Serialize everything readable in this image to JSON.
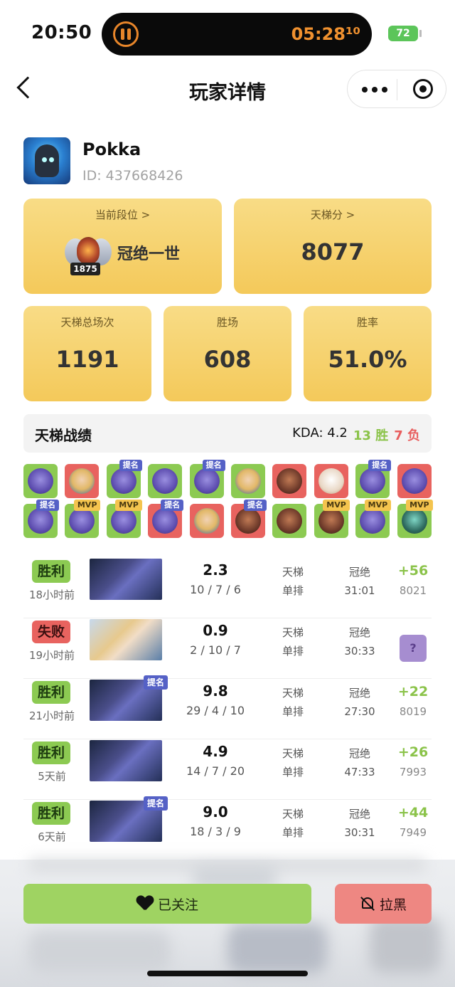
{
  "status_bar": {
    "time": "20:50",
    "timer": "05:28¹⁰",
    "battery": "72"
  },
  "nav": {
    "title": "玩家详情"
  },
  "profile": {
    "username": "Pokka",
    "id_text": "ID: 437668426"
  },
  "rank_card": {
    "label": "当前段位 >",
    "rank_name": "冠绝一世",
    "rank_number": "1875"
  },
  "ladder_card": {
    "label": "天梯分 >",
    "value": "8077"
  },
  "stats": [
    {
      "label": "天梯总场次",
      "value": "1191"
    },
    {
      "label": "胜场",
      "value": "608"
    },
    {
      "label": "胜率",
      "value": "51.0%"
    }
  ],
  "ladder_record": {
    "title": "天梯战绩",
    "kda_text": "KDA: 4.2",
    "wins_text": "13 胜",
    "losses_text": "7 负"
  },
  "hero_grid": {
    "tiles": [
      {
        "result": "win",
        "hero": "purple",
        "tag": ""
      },
      {
        "result": "loss",
        "hero": "blonde",
        "tag": ""
      },
      {
        "result": "win",
        "hero": "purple",
        "tag": "提名"
      },
      {
        "result": "win",
        "hero": "purple",
        "tag": ""
      },
      {
        "result": "win",
        "hero": "purple",
        "tag": "提名"
      },
      {
        "result": "win",
        "hero": "blonde",
        "tag": ""
      },
      {
        "result": "loss",
        "hero": "brown",
        "tag": ""
      },
      {
        "result": "loss",
        "hero": "white",
        "tag": ""
      },
      {
        "result": "win",
        "hero": "purple",
        "tag": "提名"
      },
      {
        "result": "loss",
        "hero": "purple",
        "tag": ""
      },
      {
        "result": "win",
        "hero": "purple",
        "tag": "提名"
      },
      {
        "result": "win",
        "hero": "purple",
        "tag": "MVP"
      },
      {
        "result": "win",
        "hero": "purple",
        "tag": "MVP"
      },
      {
        "result": "loss",
        "hero": "purple",
        "tag": "提名"
      },
      {
        "result": "loss",
        "hero": "blonde",
        "tag": ""
      },
      {
        "result": "loss",
        "hero": "brown",
        "tag": "提名"
      },
      {
        "result": "win",
        "hero": "brown",
        "tag": ""
      },
      {
        "result": "win",
        "hero": "brown",
        "tag": "MVP"
      },
      {
        "result": "win",
        "hero": "purple",
        "tag": "MVP"
      },
      {
        "result": "win",
        "hero": "teal",
        "tag": "MVP"
      }
    ]
  },
  "matches": [
    {
      "result": "胜利",
      "outcome": "win",
      "time_ago": "18小时前",
      "hero": "purple",
      "tag": "",
      "kda": "2.3",
      "kda_detail": "10 / 7 / 6",
      "mode_1": "天梯",
      "mode_2": "单排",
      "rank": "冠绝",
      "duration": "31:01",
      "score": "+56",
      "rating": "8021"
    },
    {
      "result": "失败",
      "outcome": "loss",
      "time_ago": "19小时前",
      "hero": "blonde",
      "tag": "",
      "kda": "0.9",
      "kda_detail": "2 / 10 / 7",
      "mode_1": "天梯",
      "mode_2": "单排",
      "rank": "冠绝",
      "duration": "30:33",
      "score": "",
      "rating": "",
      "unknown": "?"
    },
    {
      "result": "胜利",
      "outcome": "win",
      "time_ago": "21小时前",
      "hero": "purple",
      "tag": "提名",
      "kda": "9.8",
      "kda_detail": "29 / 4 / 10",
      "mode_1": "天梯",
      "mode_2": "单排",
      "rank": "冠绝",
      "duration": "27:30",
      "score": "+22",
      "rating": "8019"
    },
    {
      "result": "胜利",
      "outcome": "win",
      "time_ago": "5天前",
      "hero": "purple",
      "tag": "",
      "kda": "4.9",
      "kda_detail": "14 / 7 / 20",
      "mode_1": "天梯",
      "mode_2": "单排",
      "rank": "冠绝",
      "duration": "47:33",
      "score": "+26",
      "rating": "7993"
    },
    {
      "result": "胜利",
      "outcome": "win",
      "time_ago": "6天前",
      "hero": "purple",
      "tag": "提名",
      "kda": "9.0",
      "kda_detail": "18 / 3 / 9",
      "mode_1": "天梯",
      "mode_2": "单排",
      "rank": "冠绝",
      "duration": "30:31",
      "score": "+44",
      "rating": "7949"
    }
  ],
  "actions": {
    "follow_label": "已关注",
    "block_label": "拉黑"
  },
  "colors": {
    "win": "#8cca52",
    "loss": "#e8635f",
    "card": "#f4c95a",
    "nominate_tag": "#5561c6",
    "mvp_tag": "#f4c44e"
  }
}
